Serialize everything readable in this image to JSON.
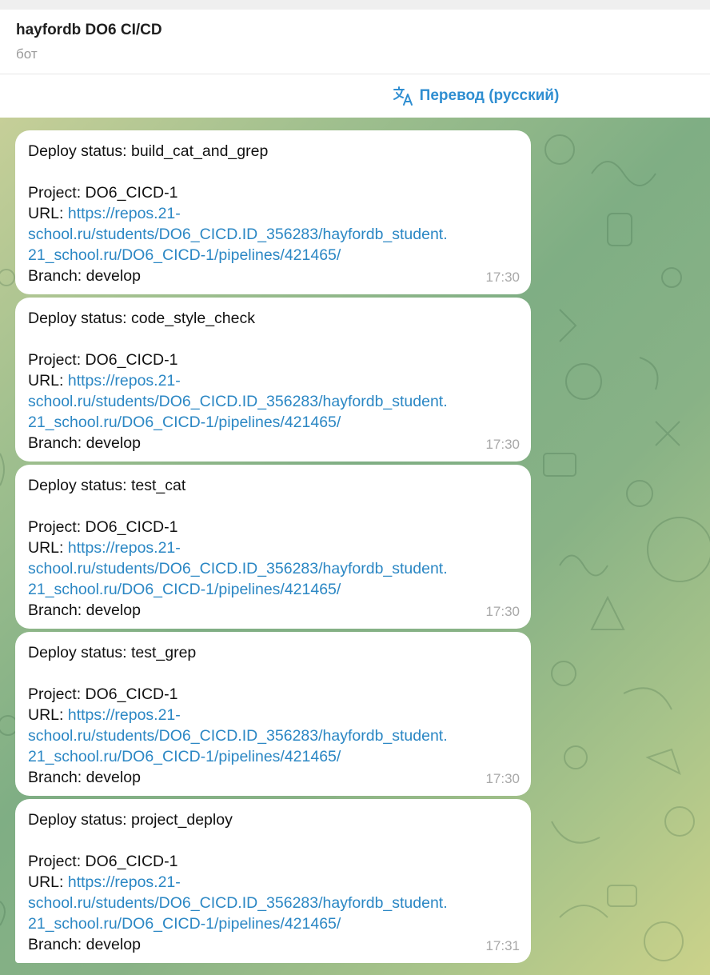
{
  "header": {
    "title": "hayfordb DO6 CI/CD",
    "subtitle": "бот"
  },
  "translate": {
    "label": "Перевод (русский)"
  },
  "messages": [
    {
      "status_label": "Deploy status: build_cat_and_grep",
      "project_label": "Project: DO6_CICD-1",
      "url_prefix": "URL: ",
      "url_line1": "https://repos.21-",
      "url_line2": "school.ru/students/DO6_CICD.ID_356283/hayfordb_student.",
      "url_line3": "21_school.ru/DO6_CICD-1/pipelines/421465/",
      "branch_label": "Branch: develop",
      "time": "17:30"
    },
    {
      "status_label": "Deploy status: code_style_check",
      "project_label": "Project: DO6_CICD-1",
      "url_prefix": "URL: ",
      "url_line1": "https://repos.21-",
      "url_line2": "school.ru/students/DO6_CICD.ID_356283/hayfordb_student.",
      "url_line3": "21_school.ru/DO6_CICD-1/pipelines/421465/",
      "branch_label": "Branch: develop",
      "time": "17:30"
    },
    {
      "status_label": "Deploy status: test_cat",
      "project_label": "Project: DO6_CICD-1",
      "url_prefix": "URL: ",
      "url_line1": "https://repos.21-",
      "url_line2": "school.ru/students/DO6_CICD.ID_356283/hayfordb_student.",
      "url_line3": "21_school.ru/DO6_CICD-1/pipelines/421465/",
      "branch_label": "Branch: develop",
      "time": "17:30"
    },
    {
      "status_label": "Deploy status: test_grep",
      "project_label": "Project: DO6_CICD-1",
      "url_prefix": "URL: ",
      "url_line1": "https://repos.21-",
      "url_line2": "school.ru/students/DO6_CICD.ID_356283/hayfordb_student.",
      "url_line3": "21_school.ru/DO6_CICD-1/pipelines/421465/",
      "branch_label": "Branch: develop",
      "time": "17:30"
    },
    {
      "status_label": "Deploy status: project_deploy",
      "project_label": "Project: DO6_CICD-1",
      "url_prefix": "URL: ",
      "url_line1": "https://repos.21-",
      "url_line2": "school.ru/students/DO6_CICD.ID_356283/hayfordb_student.",
      "url_line3": "21_school.ru/DO6_CICD-1/pipelines/421465/",
      "branch_label": "Branch: develop",
      "time": "17:31"
    }
  ],
  "icons": {
    "translate": "translate-icon"
  },
  "colors": {
    "accent": "#2f8ed1",
    "link": "#2b87c4",
    "bubble": "#ffffff",
    "time": "#a8a8a8"
  }
}
